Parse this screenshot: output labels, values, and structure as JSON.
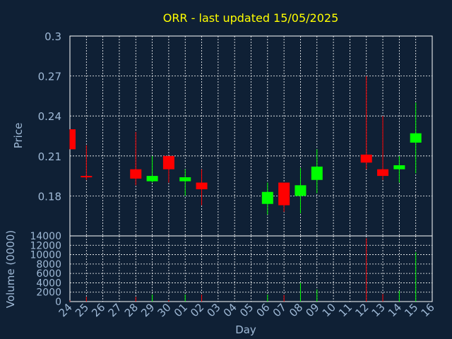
{
  "chart_data": [
    {
      "type": "candlestick",
      "title": "ORR - last updated 15/05/2025",
      "ylabel": "Price",
      "ylim": [
        0.15,
        0.3
      ],
      "yticks": [
        "0.3",
        "0.27",
        "0.24",
        "0.21",
        "0.18"
      ],
      "yticks_values": [
        0.3,
        0.27,
        0.24,
        0.21,
        0.18
      ],
      "grid": true,
      "x": [
        "24",
        "25",
        "26",
        "27",
        "28",
        "29",
        "30",
        "01",
        "02",
        "03",
        "04",
        "05",
        "06",
        "07",
        "08",
        "09",
        "10",
        "11",
        "12",
        "13",
        "14",
        "15",
        "16"
      ],
      "candles": [
        {
          "day": "24",
          "open": 0.23,
          "high": 0.23,
          "low": 0.215,
          "close": 0.215
        },
        {
          "day": "25",
          "open": 0.195,
          "high": 0.218,
          "low": 0.192,
          "close": 0.194
        },
        {
          "day": "28",
          "open": 0.2,
          "high": 0.228,
          "low": 0.188,
          "close": 0.193
        },
        {
          "day": "29",
          "open": 0.191,
          "high": 0.21,
          "low": 0.19,
          "close": 0.195
        },
        {
          "day": "30",
          "open": 0.21,
          "high": 0.21,
          "low": 0.19,
          "close": 0.2
        },
        {
          "day": "01",
          "open": 0.191,
          "high": 0.2,
          "low": 0.18,
          "close": 0.194
        },
        {
          "day": "02",
          "open": 0.19,
          "high": 0.2,
          "low": 0.173,
          "close": 0.185
        },
        {
          "day": "06",
          "open": 0.174,
          "high": 0.19,
          "low": 0.166,
          "close": 0.183
        },
        {
          "day": "07",
          "open": 0.19,
          "high": 0.19,
          "low": 0.168,
          "close": 0.173
        },
        {
          "day": "08",
          "open": 0.18,
          "high": 0.201,
          "low": 0.167,
          "close": 0.188
        },
        {
          "day": "09",
          "open": 0.192,
          "high": 0.215,
          "low": 0.182,
          "close": 0.202
        },
        {
          "day": "12",
          "open": 0.211,
          "high": 0.27,
          "low": 0.2,
          "close": 0.205
        },
        {
          "day": "13",
          "open": 0.2,
          "high": 0.24,
          "low": 0.192,
          "close": 0.195
        },
        {
          "day": "14",
          "open": 0.2,
          "high": 0.21,
          "low": 0.19,
          "close": 0.203
        },
        {
          "day": "15",
          "open": 0.22,
          "high": 0.25,
          "low": 0.197,
          "close": 0.227
        }
      ],
      "colors": {
        "up": "#00ff00",
        "down": "#ff0000",
        "background": "#0f2035",
        "grid": "#ffffff",
        "axis_text": "#9fb9d6",
        "title": "#ffff00"
      }
    },
    {
      "type": "bar",
      "ylabel": "Volume (0000)",
      "xlabel": "Day",
      "ylim": [
        0,
        14000
      ],
      "yticks": [
        "14000",
        "12000",
        "10000",
        "8000",
        "6000",
        "4000",
        "2000",
        "0"
      ],
      "yticks_values": [
        14000,
        12000,
        10000,
        8000,
        6000,
        4000,
        2000,
        0
      ],
      "categories": [
        "24",
        "25",
        "28",
        "29",
        "30",
        "01",
        "02",
        "06",
        "07",
        "08",
        "09",
        "12",
        "13",
        "14",
        "15"
      ],
      "values": [
        200,
        1000,
        1000,
        1500,
        300,
        1500,
        1500,
        1500,
        1400,
        4000,
        2600,
        13500,
        1600,
        2300,
        10500
      ],
      "directions": [
        "down",
        "down",
        "down",
        "up",
        "down",
        "up",
        "down",
        "up",
        "down",
        "up",
        "up",
        "down",
        "down",
        "up",
        "up"
      ]
    }
  ]
}
